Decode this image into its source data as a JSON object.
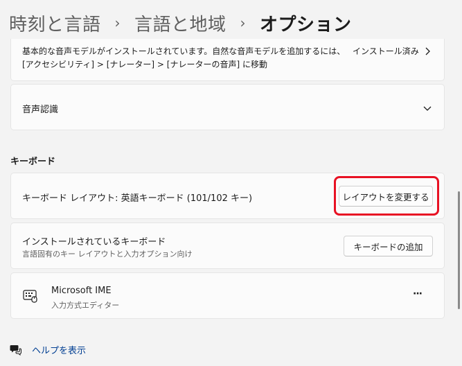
{
  "breadcrumb": {
    "items": [
      "時刻と言語",
      "言語と地域",
      "オプション"
    ],
    "separator": "›"
  },
  "voice_card": {
    "line1": "基本的な音声モデルがインストールされています。自然な音声モデルを追加するには、",
    "line2": "[アクセシビリティ] > [ナレーター] > [ナレーターの音声] に移動",
    "status": "インストール済み"
  },
  "speech_card": {
    "label": "音声認識"
  },
  "keyboard": {
    "section_title": "キーボード",
    "layout_label": "キーボード レイアウト: 英語キーボード (101/102 キー)",
    "change_layout_button": "レイアウトを変更する",
    "installed_title": "インストールされているキーボード",
    "installed_subtitle": "言語固有のキー レイアウトと入力オプション向け",
    "add_keyboard_button": "キーボードの追加",
    "ime_name": "Microsoft IME",
    "ime_subtitle": "入力方式エディター",
    "more_label": "···"
  },
  "help": {
    "label": "ヘルプを表示"
  },
  "colors": {
    "highlight": "#e81123",
    "link": "#003e92"
  }
}
